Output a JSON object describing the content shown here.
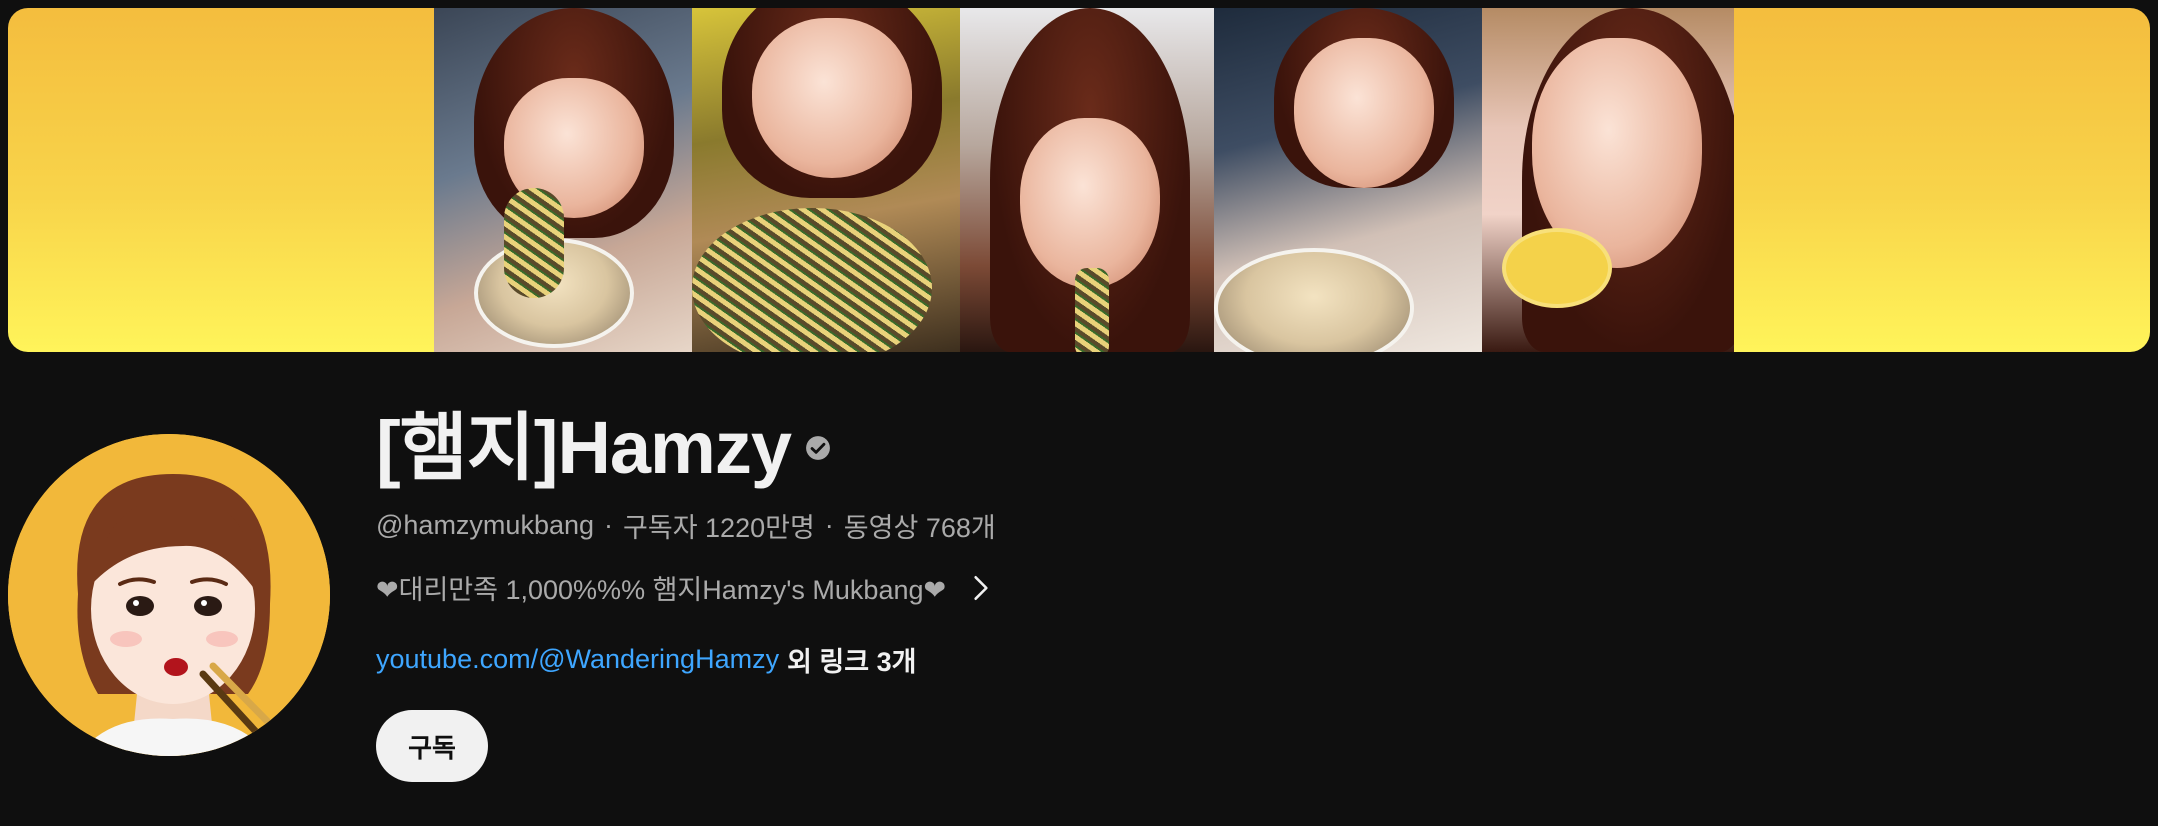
{
  "channel": {
    "name": "[햄지]Hamzy",
    "handle": "@hamzymukbang",
    "separator": "·",
    "subscribers": "구독자 1220만명",
    "videos": "동영상 768개",
    "description": "❤대리만족 1,000%%% 햄지Hamzy's Mukbang❤",
    "link_text": "youtube.com/@WanderingHamzy",
    "more_links": "외 링크 3개",
    "subscribe_label": "구독"
  },
  "icons": {
    "verified": "verified-check-icon",
    "description_more": "chevron-right-icon"
  },
  "colors": {
    "background": "#0f0f0f",
    "link": "#3ea6ff",
    "banner_yellow": "#f8d44a",
    "subscribe_bg": "#f1f1f1"
  }
}
